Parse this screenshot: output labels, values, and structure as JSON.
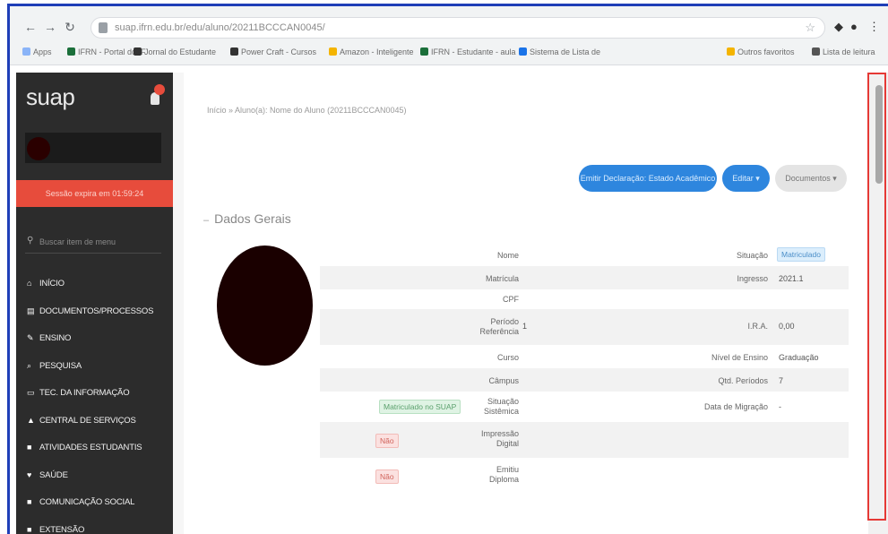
{
  "browser": {
    "url": "suap.ifrn.edu.br/edu/aluno/20211BCCCAN0045/",
    "bookmarks": [
      "Apps",
      "IFRN - Portal do IF",
      "Jornal do Estudante",
      "Power Craft - Cursos",
      "Amazon - Inteligente",
      "IFRN - Estudante - aula",
      "Sistema de Lista de",
      "Outros favoritos",
      "Lista de leitura"
    ]
  },
  "sidebar": {
    "logo": "suap",
    "session_text": "Sessão expira em 01:59:24",
    "search_placeholder": "Buscar item de menu",
    "menu": [
      {
        "icon": "home-icon",
        "glyph": "⌂",
        "label": "INÍCIO"
      },
      {
        "icon": "documents-icon",
        "glyph": "▤",
        "label": "DOCUMENTOS/PROCESSOS"
      },
      {
        "icon": "graduation-icon",
        "glyph": "✎",
        "label": "ENSINO"
      },
      {
        "icon": "research-icon",
        "glyph": "⌕",
        "label": "PESQUISA"
      },
      {
        "icon": "monitor-icon",
        "glyph": "▭",
        "label": "TEC. DA INFORMAÇÃO"
      },
      {
        "icon": "services-icon",
        "glyph": "▲",
        "label": "CENTRAL DE SERVIÇOS"
      },
      {
        "icon": "activities-icon",
        "glyph": "■",
        "label": "ATIVIDADES ESTUDANTIS"
      },
      {
        "icon": "health-icon",
        "glyph": "♥",
        "label": "SAÚDE"
      },
      {
        "icon": "communication-icon",
        "glyph": "■",
        "label": "COMUNICAÇÃO SOCIAL"
      },
      {
        "icon": "extension-icon",
        "glyph": "■",
        "label": "EXTENSÃO"
      }
    ]
  },
  "main": {
    "breadcrumb": "Início » Aluno(a): Nome do Aluno (20211BCCCAN0045)",
    "buttons": {
      "primary": "Emitir Declaração: Estado Acadêmico",
      "edit": "Editar ▾",
      "docs": "Documentos ▾"
    },
    "section_title": "Dados Gerais",
    "fields": {
      "nome_label": "Nome",
      "matricula_label": "Matrícula",
      "cpf_label": "CPF",
      "periodo_label": "Período Referência",
      "periodo_value": "1",
      "curso_label": "Curso",
      "campus_label": "Câmpus",
      "situacao_sistemica_label": "Situação Sistêmica",
      "situacao_sistemica_value": "Matriculado no SUAP",
      "impressao_label": "Impressão Digital",
      "impressao_value": "Não",
      "emitiu_label": "Emitiu Diploma",
      "emitiu_value": "Não",
      "situacao_label": "Situação",
      "situacao_value": "Matriculado",
      "ingresso_label": "Ingresso",
      "ingresso_value": "2021.1",
      "ira_label": "I.R.A.",
      "ira_value": "0,00",
      "nivel_label": "Nível de Ensino",
      "nivel_value": "Graduação",
      "qtd_label": "Qtd. Períodos",
      "qtd_value": "7",
      "migracao_label": "Data de Migração",
      "migracao_value": "-"
    }
  }
}
